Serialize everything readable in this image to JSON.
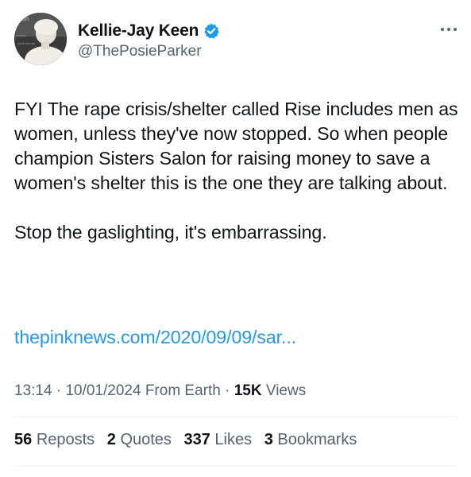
{
  "author": {
    "display_name": "Kellie-Jay Keen",
    "handle": "@ThePosieParker",
    "verified": true,
    "avatar_icon": "profile-photo"
  },
  "colors": {
    "text": "#0f1419",
    "secondary": "#536471",
    "link": "#1d9bf0",
    "verified_badge": "#1d9bf0"
  },
  "tweet": {
    "paragraph_1": "FYI The rape crisis/shelter called Rise includes men as women, unless they've now stopped. So when people champion Sisters Salon for raising money to save a women's shelter this is the one they are talking about.",
    "paragraph_2": "Stop the gaslighting, it's embarrassing.",
    "link_text": "thepinknews.com/2020/09/09/sar..."
  },
  "meta": {
    "time": "13:14",
    "separator": "·",
    "date": "10/01/2024",
    "source": "From Earth",
    "views_count": "15K",
    "views_label": "Views"
  },
  "stats": {
    "reposts_count": "56",
    "reposts_label": "Reposts",
    "quotes_count": "2",
    "quotes_label": "Quotes",
    "likes_count": "337",
    "likes_label": "Likes",
    "bookmarks_count": "3",
    "bookmarks_label": "Bookmarks"
  }
}
